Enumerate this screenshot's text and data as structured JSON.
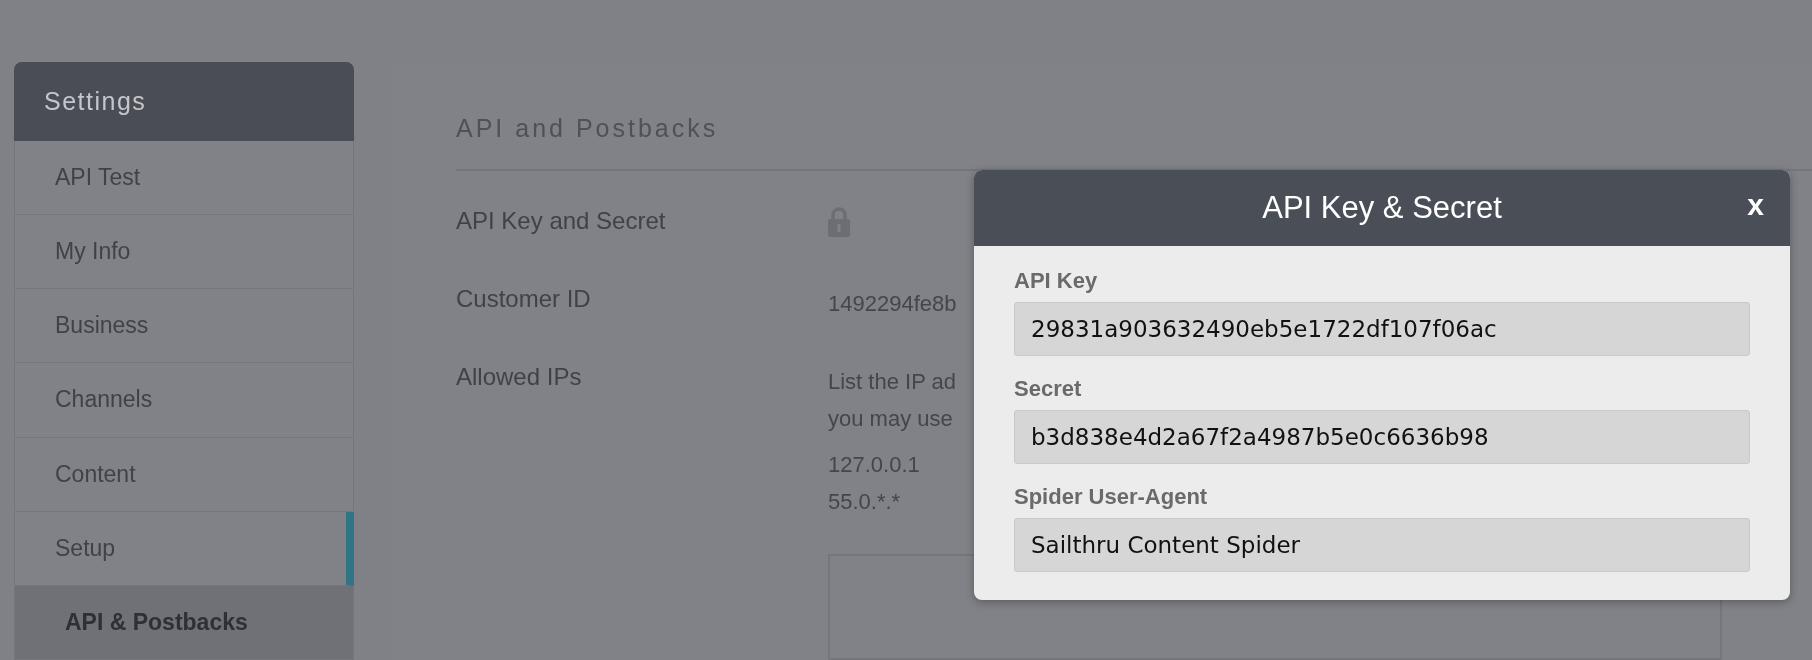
{
  "sidebar": {
    "title": "Settings",
    "items": [
      {
        "label": "API Test",
        "selected": false,
        "hovered": false
      },
      {
        "label": "My Info",
        "selected": false,
        "hovered": false
      },
      {
        "label": "Business",
        "selected": false,
        "hovered": false
      },
      {
        "label": "Channels",
        "selected": false,
        "hovered": false
      },
      {
        "label": "Content",
        "selected": false,
        "hovered": false
      },
      {
        "label": "Setup",
        "selected": false,
        "hovered": true
      },
      {
        "label": "API & Postbacks",
        "selected": true,
        "hovered": false
      }
    ]
  },
  "main": {
    "title": "API and Postbacks",
    "rows": [
      {
        "kind": "lock",
        "label": "API Key and Secret"
      },
      {
        "kind": "text",
        "label": "Customer ID",
        "value": "1492294fe8b"
      },
      {
        "kind": "ips",
        "label": "Allowed IPs",
        "description": [
          "List the IP ad",
          "you may use"
        ],
        "ips": [
          "127.0.0.1",
          "55.0.*.*"
        ]
      }
    ]
  },
  "modal": {
    "title": "API Key & Secret",
    "close": "x",
    "fields": [
      {
        "label": "API Key",
        "value": "29831a903632490eb5e1722df107f06ac"
      },
      {
        "label": "Secret",
        "value": "b3d838e4d2a67f2a4987b5e0c6636b98"
      },
      {
        "label": "Spider User-Agent",
        "value": "Sailthru Content Spider"
      }
    ]
  }
}
